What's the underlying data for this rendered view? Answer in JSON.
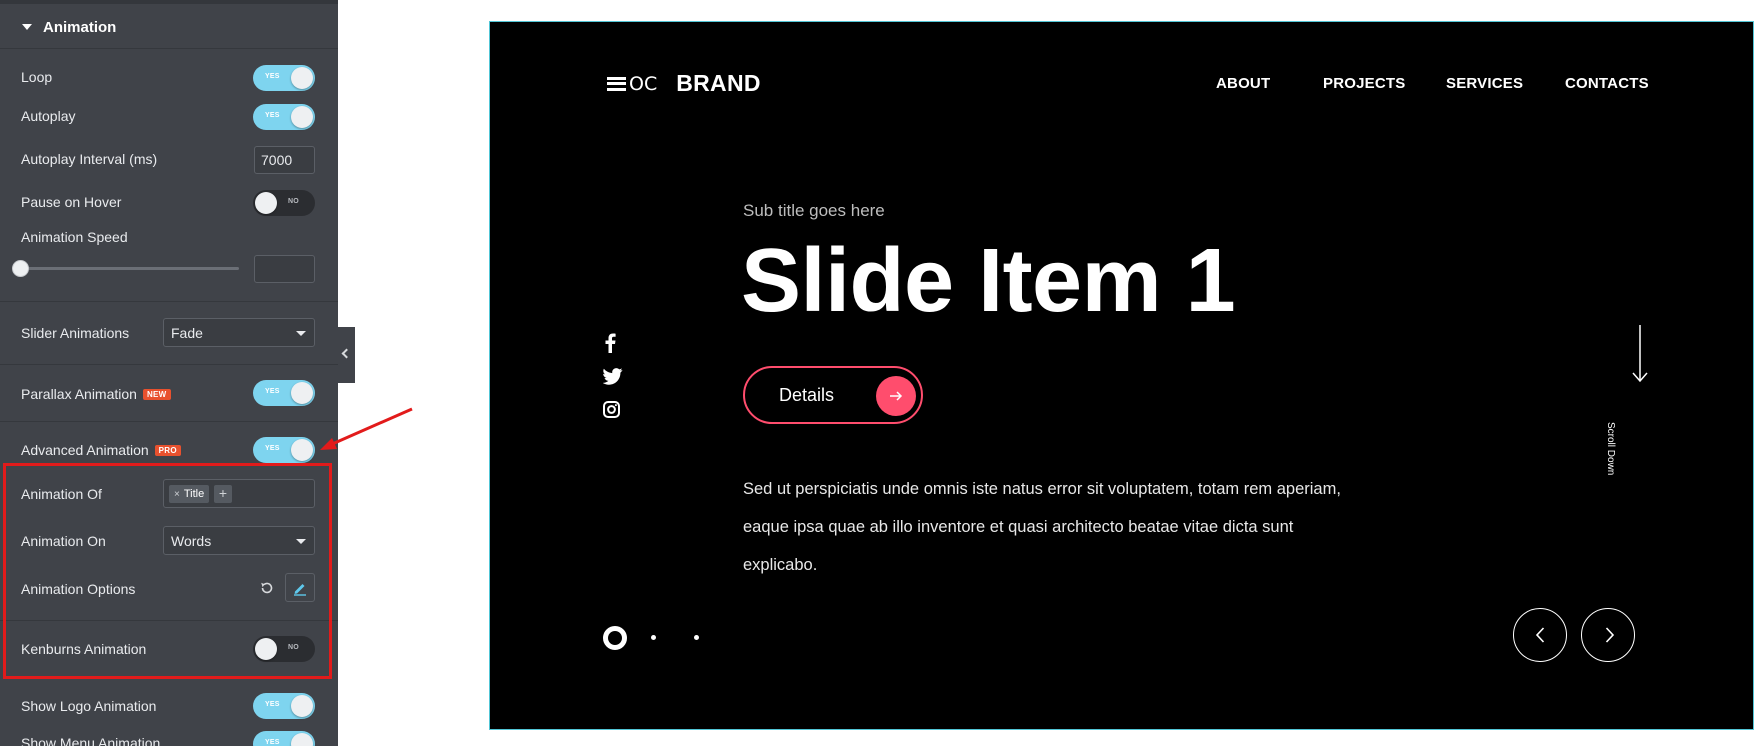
{
  "panel": {
    "section_title": "Animation",
    "loop": {
      "label": "Loop",
      "state": "YES"
    },
    "autoplay": {
      "label": "Autoplay",
      "state": "YES"
    },
    "autoplay_interval": {
      "label": "Autoplay Interval (ms)",
      "value": "7000"
    },
    "pause_on_hover": {
      "label": "Pause on Hover",
      "state": "NO"
    },
    "animation_speed": {
      "label": "Animation Speed",
      "slider_value": 0,
      "value": ""
    },
    "slider_animations": {
      "label": "Slider Animations",
      "value": "Fade"
    },
    "parallax_animation": {
      "label": "Parallax Animation",
      "badge": "NEW",
      "state": "YES"
    },
    "advanced_animation": {
      "label": "Advanced Animation",
      "badge": "PRO",
      "state": "YES"
    },
    "animation_of": {
      "label": "Animation Of",
      "tag": "Title",
      "tag_remove": "×",
      "add": "+"
    },
    "animation_on": {
      "label": "Animation On",
      "value": "Words"
    },
    "animation_options": {
      "label": "Animation Options"
    },
    "kenburns_animation": {
      "label": "Kenburns Animation",
      "state": "NO"
    },
    "show_logo_animation": {
      "label": "Show Logo Animation",
      "state": "YES"
    },
    "show_menu_animation": {
      "label": "Show Menu Animation",
      "state": "YES"
    }
  },
  "preview": {
    "brand": {
      "prefix": "OC",
      "name": "BRAND"
    },
    "nav": [
      "ABOUT",
      "PROJECTS",
      "SERVICES",
      "CONTACTS"
    ],
    "social_icons": [
      "facebook-icon",
      "twitter-icon",
      "instagram-icon"
    ],
    "subtitle": "Sub title goes here",
    "title": "Slide Item 1",
    "button_label": "Details",
    "description": "Sed ut perspiciatis unde omnis iste natus error sit voluptatem, totam rem aperiam, eaque ipsa quae ab illo inventore et quasi architecto beataе vitae dicta sunt explicabo.",
    "scroll_label": "Scroll Down",
    "pagination": {
      "active": 1,
      "total": 3
    },
    "colors": {
      "accent": "#ff4d6d",
      "toggle_on": "#7ed4ef",
      "highlight": "#e21b1b",
      "frame": "#52c6d6"
    }
  }
}
